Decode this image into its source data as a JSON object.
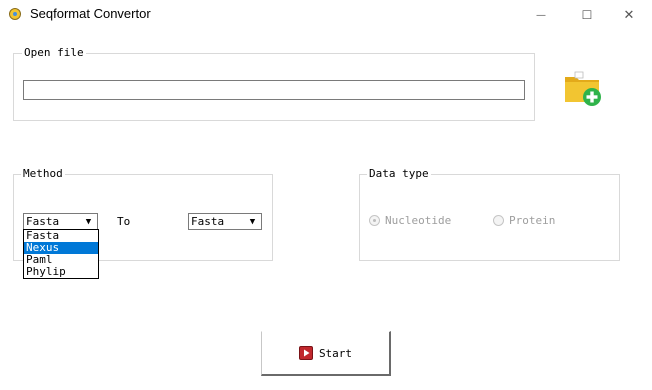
{
  "window": {
    "title": "Seqformat Convertor",
    "minimize_glyph": "—",
    "maximize_glyph": "☐",
    "close_glyph": "✕"
  },
  "open_file": {
    "label": "Open file",
    "path_value": "",
    "add_icon": "folder-add-icon"
  },
  "method": {
    "label": "Method",
    "from_value": "Fasta",
    "to_label": "To",
    "to_value": "Fasta",
    "from_options": [
      "Fasta",
      "Nexus",
      "Paml",
      "Phylip"
    ],
    "highlighted_option": "Nexus"
  },
  "data_type": {
    "label": "Data type",
    "options": [
      {
        "label": "Nucleotide",
        "checked": true
      },
      {
        "label": "Protein",
        "checked": false
      }
    ]
  },
  "start_button": {
    "label": "Start",
    "icon": "play-icon"
  },
  "colors": {
    "selection": "#0078d7",
    "play_red": "#c1272d",
    "folder_yellow": "#f2c531",
    "plus_green": "#2fb34a"
  }
}
